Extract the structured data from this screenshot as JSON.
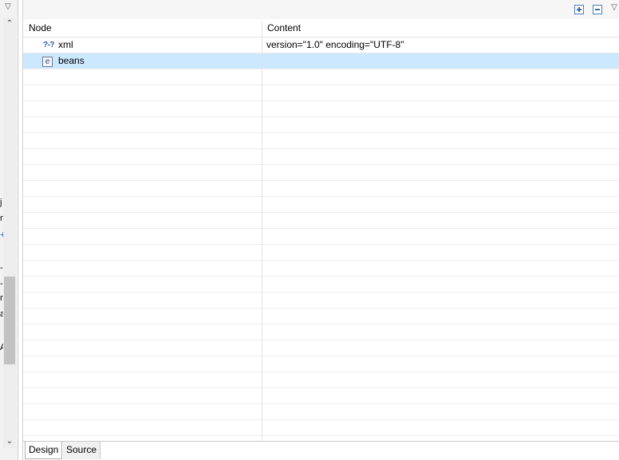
{
  "toolbar": {
    "expand_all_icon": "expand-all-icon",
    "collapse_all_icon": "collapse-all-icon",
    "view_menu_glyph": "▽"
  },
  "left_pane": {
    "menu_glyph": "▽",
    "scroll_up_glyph": "⌃",
    "scroll_down_glyph": "⌄",
    "fragments": [
      "j",
      "n",
      "+",
      "-",
      "-",
      "n",
      "a",
      "A"
    ]
  },
  "tree": {
    "columns": {
      "node": "Node",
      "content": "Content"
    },
    "rows": [
      {
        "icon": "processing-instruction-icon",
        "icon_glyph": "?-?",
        "node": "xml",
        "content": "version=\"1.0\" encoding=\"UTF-8\"",
        "selected": false
      },
      {
        "icon": "element-icon",
        "icon_glyph": "e",
        "node": "beans",
        "content": "",
        "selected": true
      }
    ]
  },
  "tabs": {
    "design": "Design",
    "source": "Source",
    "active": "Design"
  },
  "colors": {
    "selection": "#cce8ff",
    "toolbar_icon": "#3a6ea5"
  }
}
